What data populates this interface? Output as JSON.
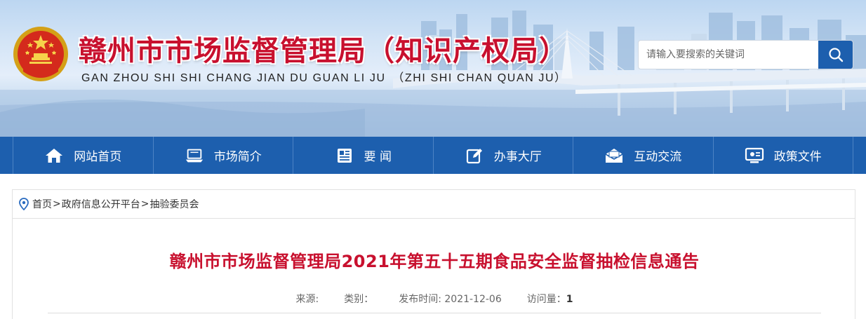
{
  "header": {
    "site_title": "赣州市市场监督管理局（知识产权局）",
    "site_subtitle": "GAN ZHOU SHI SHI CHANG JIAN DU GUAN LI JU　（ZHI SHI CHAN QUAN JU）",
    "emblem_icon": "national-emblem-icon",
    "search": {
      "placeholder": "请输入要搜索的关键词",
      "value": "",
      "button_icon": "search-icon"
    }
  },
  "nav": {
    "items": [
      {
        "label": "网站首页",
        "icon": "home-icon"
      },
      {
        "label": "市场简介",
        "icon": "laptop-icon"
      },
      {
        "label": "要 闻",
        "icon": "news-icon"
      },
      {
        "label": "办事大厅",
        "icon": "edit-icon"
      },
      {
        "label": "互动交流",
        "icon": "mail-icon"
      },
      {
        "label": "政策文件",
        "icon": "monitor-icon"
      }
    ]
  },
  "breadcrumb": {
    "icon": "location-pin-icon",
    "items": [
      "首页",
      "政府信息公开平台",
      "抽验委员会"
    ],
    "separator": ">"
  },
  "article": {
    "title": "赣州市市场监督管理局2021年第五十五期食品安全监督抽检信息通告",
    "meta": {
      "source_label": "来源:",
      "category_label": "类别：",
      "publish_label": "发布时间:",
      "publish_date": "2021-12-06",
      "views_label": "访问量：",
      "views": "1"
    }
  },
  "colors": {
    "brand_blue": "#1d5fae",
    "title_red": "#c8102e"
  }
}
